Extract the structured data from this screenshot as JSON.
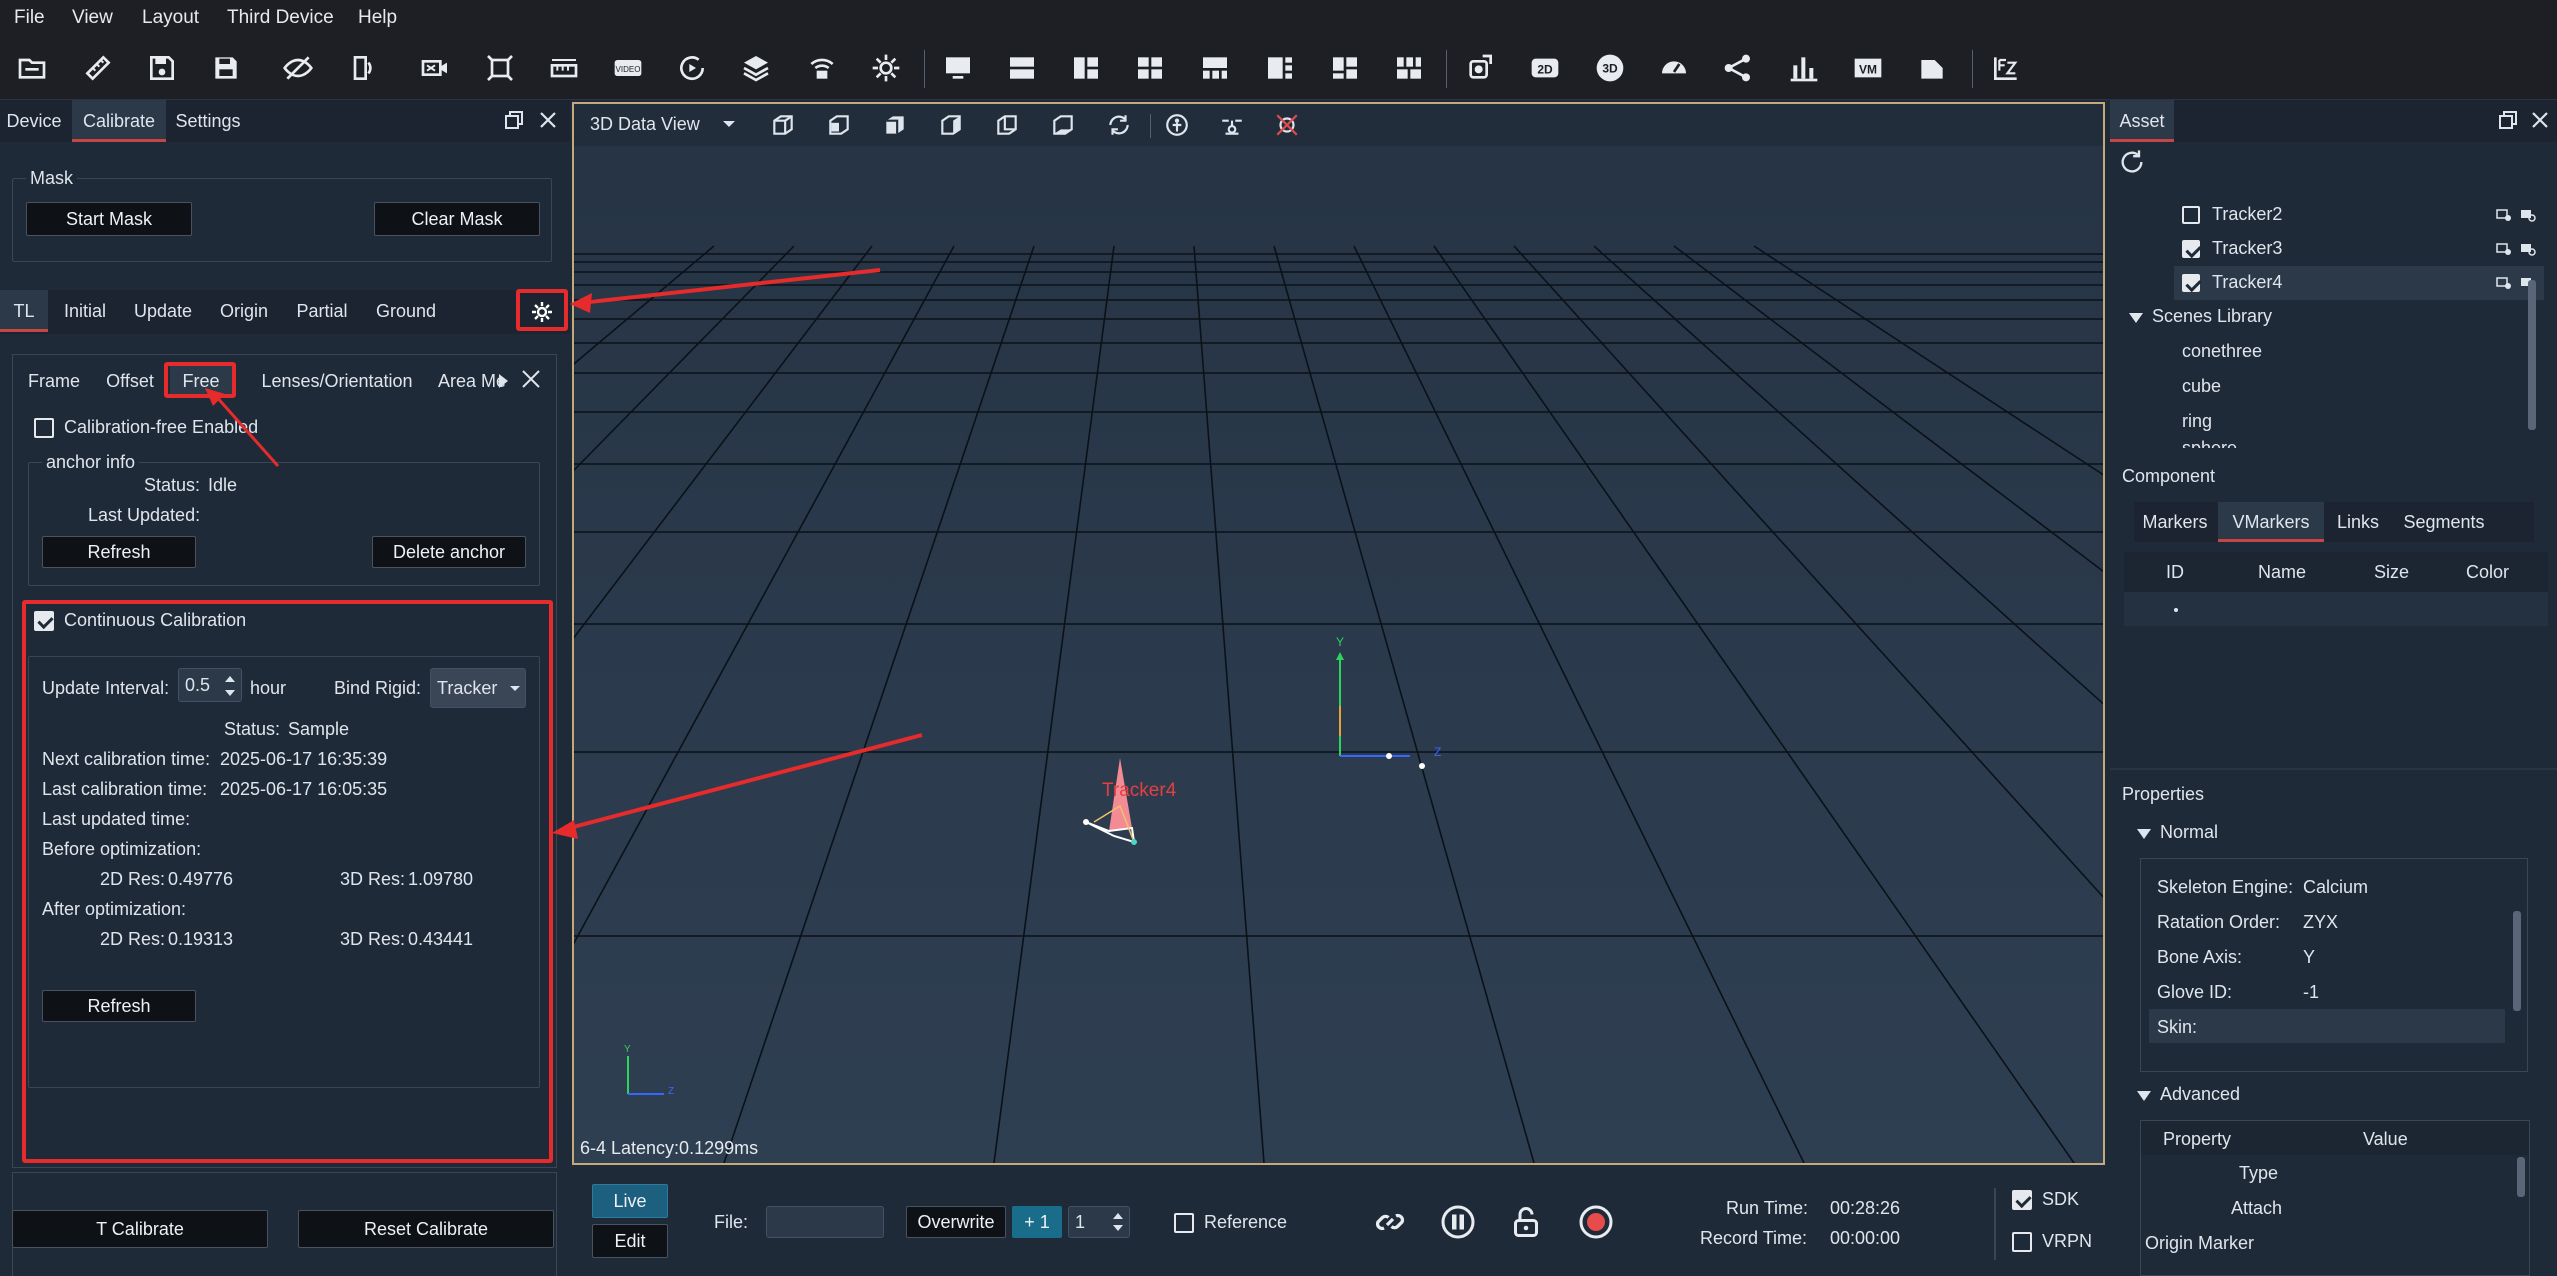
{
  "menu": [
    "File",
    "View",
    "Layout",
    "Third Device",
    "Help"
  ],
  "toolbar_icons": [
    "open-folder-icon",
    "ruler-icon",
    "save-icon",
    "save-as-icon",
    "eye-off-icon",
    "camera-switch-icon",
    "camera-off-icon",
    "crop-icon",
    "measure-icon",
    "video-icon",
    "replay-icon",
    "layers-icon",
    "wifi-camera-icon",
    "settings-gear-icon",
    "monitor-icon",
    "layout-2-icon",
    "layout-3-icon",
    "layout-4-icon",
    "layout-5-icon",
    "layout-6-icon",
    "layout-7-icon",
    "layout-8-icon",
    "rotate-camera-icon",
    "2d-icon",
    "3d-icon",
    "gauge-icon",
    "graph-icon",
    "bar-chart-icon",
    "vm-icon",
    "document-icon",
    "fz-icon"
  ],
  "left_tabs": [
    "Device",
    "Calibrate",
    "Settings"
  ],
  "mask": {
    "title": "Mask",
    "start": "Start Mask",
    "clear": "Clear Mask"
  },
  "cal_tabs": [
    "TL",
    "Initial",
    "Update",
    "Origin",
    "Partial",
    "Ground"
  ],
  "sub_tabs": [
    "Frame",
    "Offset",
    "Free",
    "Lenses/Orientation",
    "Area Me"
  ],
  "free": {
    "enabled_label": "Calibration-free Enabled",
    "anchor_title": "anchor info",
    "status_label": "Status:",
    "status_value": "Idle",
    "last_updated_label": "Last Updated:",
    "refresh": "Refresh",
    "delete_anchor": "Delete anchor"
  },
  "continuous": {
    "label": "Continuous Calibration",
    "interval_label": "Update Interval:",
    "interval_value": "0.5",
    "interval_unit": "hour",
    "bind_label": "Bind Rigid:",
    "bind_value": "Tracker",
    "status_label": "Status:",
    "status_value": "Sample",
    "next_label": "Next calibration time:",
    "next_value": "2025-06-17 16:35:39",
    "last_label": "Last calibration time:",
    "last_value": "2025-06-17 16:05:35",
    "last_updated_label": "Last updated time:",
    "before_label": "Before optimization:",
    "after_label": "After optimization:",
    "res2d_label": "2D Res:",
    "res3d_label": "3D Res:",
    "before_2d": "0.49776",
    "before_3d": "1.09780",
    "after_2d": "0.19313",
    "after_3d": "0.43441",
    "refresh": "Refresh"
  },
  "left_bottom": {
    "t_calibrate": "T Calibrate",
    "reset_calibrate": "Reset Calibrate"
  },
  "viewport": {
    "view_name": "3D Data View",
    "tracker_label": "Tracker4",
    "latency": "6-4 Latency:0.1299ms",
    "axis_y": "Y",
    "axis_z": "Z"
  },
  "bottom": {
    "live": "Live",
    "edit": "Edit",
    "file_label": "File:",
    "overwrite": "Overwrite",
    "plus_one": "+ 1",
    "take_value": "1",
    "reference": "Reference",
    "run_time_label": "Run Time:",
    "run_time_value": "00:28:26",
    "record_time_label": "Record Time:",
    "record_time_value": "00:00:00",
    "sdk": "SDK",
    "vrpn": "VRPN"
  },
  "asset": {
    "tab": "Asset",
    "trackers": [
      "Tracker2",
      "Tracker3",
      "Tracker4"
    ],
    "scenes_library": "Scenes Library",
    "scenes": [
      "conethree",
      "cube",
      "ring",
      "sphere"
    ]
  },
  "component": {
    "title": "Component",
    "tabs": [
      "Markers",
      "VMarkers",
      "Links",
      "Segments"
    ],
    "columns": [
      "ID",
      "Name",
      "Size",
      "Color"
    ]
  },
  "properties": {
    "title": "Properties",
    "normal": "Normal",
    "rows": [
      {
        "label": "Skeleton Engine:",
        "value": "Calcium"
      },
      {
        "label": "Ratation Order:",
        "value": "ZYX"
      },
      {
        "label": "Bone Axis:",
        "value": "Y"
      },
      {
        "label": "Glove ID:",
        "value": "-1"
      },
      {
        "label": "Skin:",
        "value": ""
      }
    ],
    "advanced": "Advanced",
    "adv_columns": [
      "Property",
      "Value"
    ],
    "adv_rows": [
      "Type",
      "Attach",
      "Origin Marker"
    ]
  },
  "colors": {
    "accent_red": "#e52b2b",
    "active_tab_line": "#c84545",
    "viewport_border": "#c6a97a",
    "live_button": "#1d5f7e",
    "plus_button": "#1a6d8a"
  }
}
